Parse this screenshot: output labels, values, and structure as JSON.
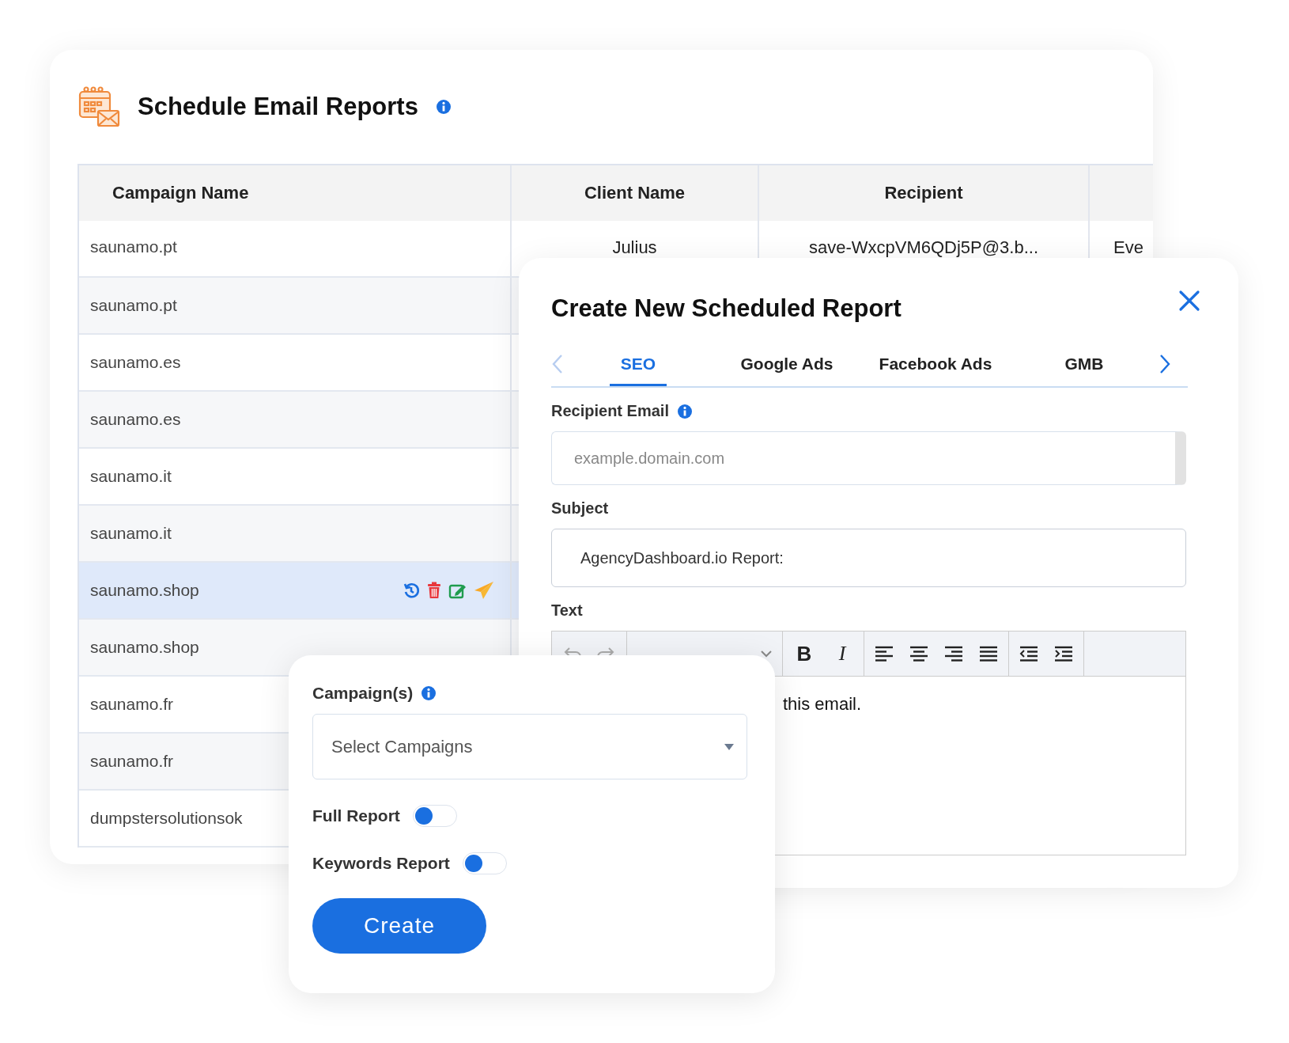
{
  "page": {
    "title": "Schedule Email Reports"
  },
  "table": {
    "columns": [
      "Campaign Name",
      "Client Name",
      "Recipient"
    ],
    "rows": [
      {
        "campaign": "saunamo.pt",
        "client": "Julius",
        "recipient": "save-WxcpVM6QDj5P@3.b...",
        "column_4": "Eve",
        "selected": false
      },
      {
        "campaign": "saunamo.pt",
        "selected": false
      },
      {
        "campaign": "saunamo.es",
        "selected": false
      },
      {
        "campaign": "saunamo.es",
        "selected": false
      },
      {
        "campaign": "saunamo.it",
        "selected": false
      },
      {
        "campaign": "saunamo.it",
        "selected": false
      },
      {
        "campaign": "saunamo.shop",
        "selected": true
      },
      {
        "campaign": "saunamo.shop",
        "selected": false
      },
      {
        "campaign": "saunamo.fr",
        "selected": false
      },
      {
        "campaign": "saunamo.fr",
        "selected": false
      },
      {
        "campaign": "dumpstersolutionsok",
        "selected": false
      }
    ]
  },
  "modal": {
    "title": "Create New Scheduled Report",
    "tabs": [
      {
        "label": "SEO",
        "selected": true
      },
      {
        "label": "Google Ads",
        "selected": false
      },
      {
        "label": "Facebook Ads",
        "selected": false
      },
      {
        "label": "GMB",
        "selected": false
      }
    ],
    "recipient": {
      "label": "Recipient Email",
      "placeholder": "example.domain.com"
    },
    "subject": {
      "label": "Subject",
      "value": "AgencyDashboard.io Report:"
    },
    "text": {
      "label": "Text",
      "bold": "B",
      "italic": "I",
      "body": "this email."
    }
  },
  "form": {
    "campaigns": {
      "label": "Campaign(s)",
      "placeholder": "Select Campaigns"
    },
    "toggles": [
      {
        "label": "Full Report",
        "on": false
      },
      {
        "label": "Keywords Report",
        "on": false
      }
    ],
    "button": "Create"
  }
}
